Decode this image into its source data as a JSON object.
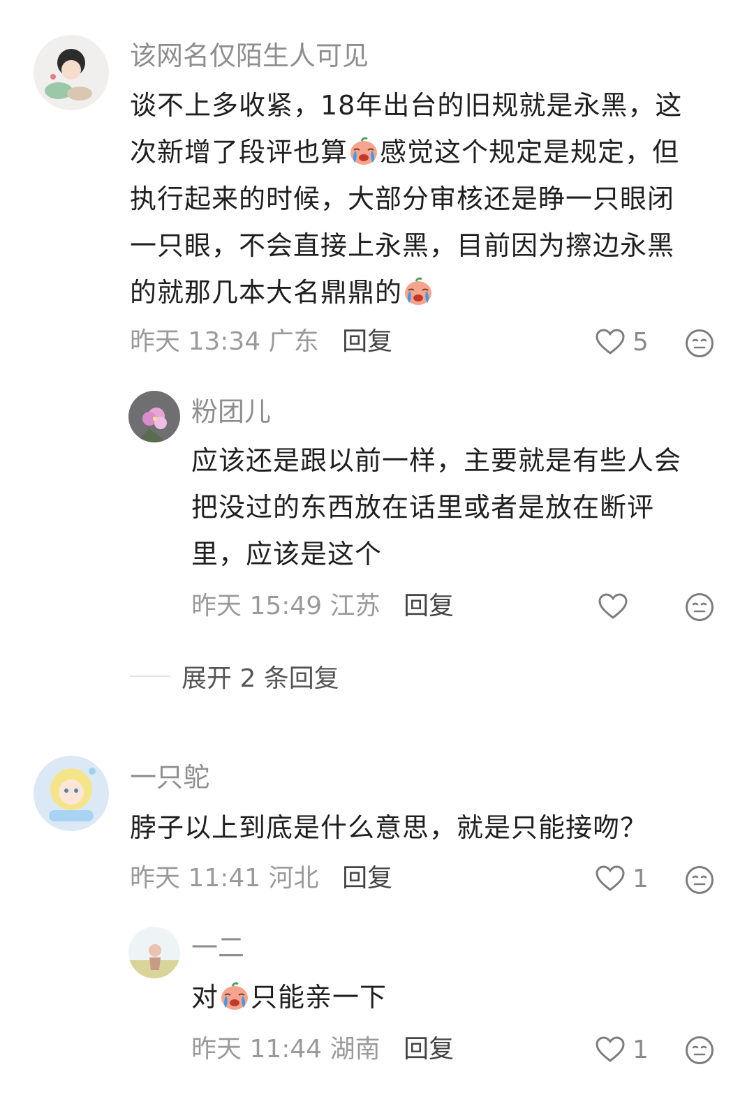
{
  "comments": [
    {
      "username": "该网名仅陌生人可见",
      "lines": [
        "谈不上多收紧，18年出台的旧规就是永黑，这",
        "次新增了段评也算",
        "感觉这个规定是规定，但",
        "执行起来的时候，大部分审核还是睁一只眼闭",
        "一只眼，不会直接上永黑，目前因为擦边永黑",
        "的就那几本大名鼎鼎的"
      ],
      "time": "昨天 13:34",
      "location": "广东",
      "reply_label": "回复",
      "likes": "5",
      "replies": [
        {
          "username": "粉团儿",
          "lines": [
            "应该还是跟以前一样，主要就是有些人会",
            "把没过的东西放在话里或者是放在断评",
            "里，应该是这个"
          ],
          "time": "昨天 15:49",
          "location": "江苏",
          "reply_label": "回复",
          "likes": ""
        }
      ],
      "expand_label": "展开 2 条回复"
    },
    {
      "username": "一只鸵",
      "lines": [
        "脖子以上到底是什么意思，就是只能接吻？"
      ],
      "time": "昨天 11:41",
      "location": "河北",
      "reply_label": "回复",
      "likes": "1",
      "replies": [
        {
          "username": "一二",
          "lines": [
            "对",
            "只能亲一下"
          ],
          "time": "昨天 11:44",
          "location": "湖南",
          "reply_label": "回复",
          "likes": "1"
        }
      ]
    }
  ],
  "icons": {
    "like": "heart-outline-icon",
    "react": "neutral-face-icon",
    "emoji": "crying-face-emoji"
  },
  "colors": {
    "username": "#8e8e8e",
    "meta": "#9a9a9a",
    "text": "#1f1f1f"
  }
}
